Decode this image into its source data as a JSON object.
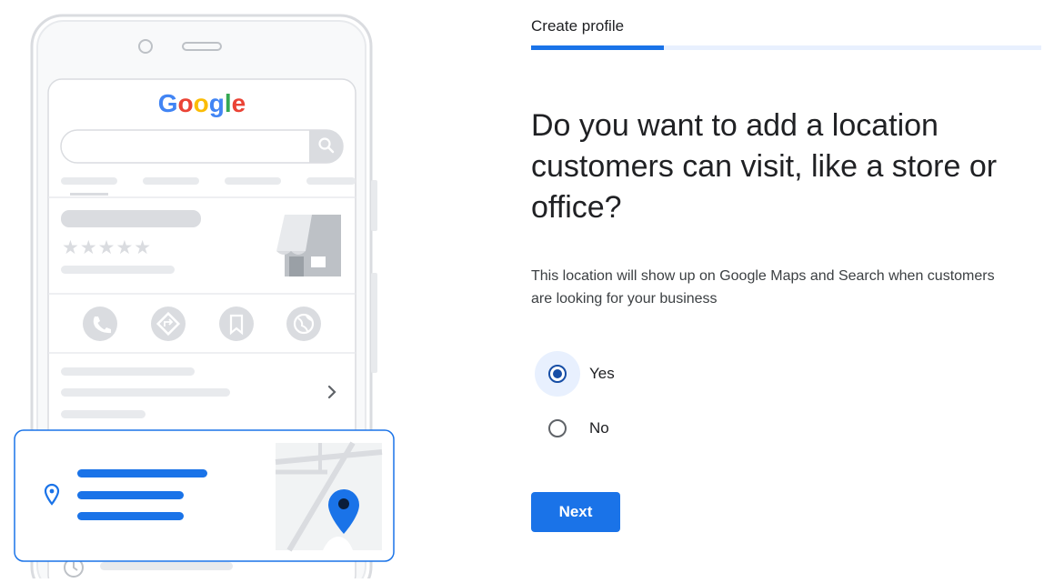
{
  "illustration": {
    "brand_logo": "Google",
    "logo_colors": [
      "#4285F4",
      "#EA4335",
      "#FBBC05",
      "#4285F4",
      "#34A853",
      "#EA4335"
    ],
    "rating_stars": "★★★★★",
    "action_icons": [
      "phone-icon",
      "directions-icon",
      "bookmark-icon",
      "globe-icon"
    ],
    "card_icons": [
      "location-pin-icon",
      "map-pin-icon"
    ],
    "chevron": "›"
  },
  "header": {
    "step_label": "Create profile",
    "progress_fraction": 0.26
  },
  "main": {
    "question": "Do you want to add a location customers can visit, like a store or office?",
    "description": "This location will show up on Google Maps and Search when customers are looking for your business",
    "options": [
      {
        "label": "Yes",
        "selected": true
      },
      {
        "label": "No",
        "selected": false
      }
    ],
    "next_label": "Next"
  },
  "colors": {
    "accent": "#1a73e8",
    "selected_radio": "#174ea6",
    "selected_halo": "#e8f0fe",
    "placeholder_gray": "#dadce0"
  }
}
